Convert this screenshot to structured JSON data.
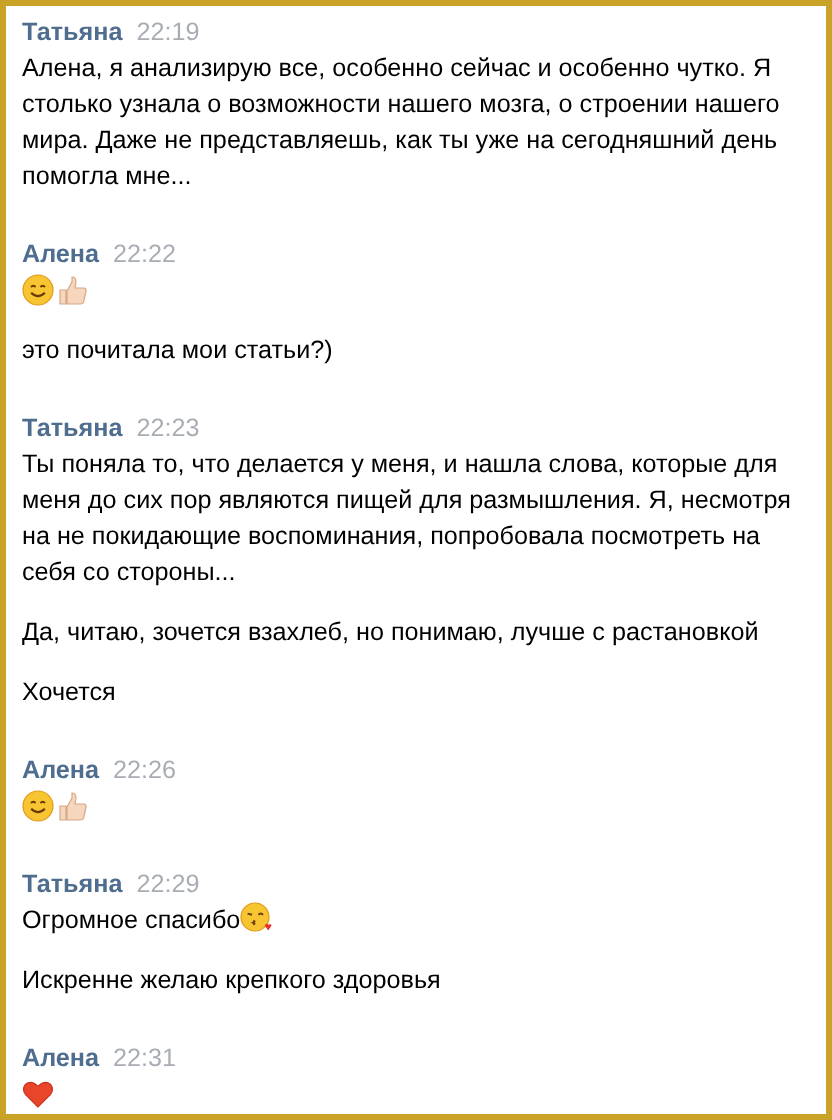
{
  "messages": [
    {
      "author": "Татьяна",
      "time": "22:19",
      "items": [
        {
          "kind": "text",
          "text": "Алена, я анализирую все, особенно сейчас и особенно чутко. Я столько узнала о возможности нашего мозга, о строении нашего мира. Даже не представляешь, как ты уже на сегодняшний день помогла мне..."
        }
      ]
    },
    {
      "author": "Алена",
      "time": "22:22",
      "items": [
        {
          "kind": "emoji",
          "icons": [
            {
              "kind": "smile"
            },
            {
              "kind": "thumb"
            }
          ]
        },
        {
          "kind": "text",
          "text": "это почитала мои статьи?)"
        }
      ]
    },
    {
      "author": "Татьяна",
      "time": "22:23",
      "items": [
        {
          "kind": "text",
          "text": "Ты поняла то, что делается у меня, и нашла слова, которые для меня до сих пор являются пищей для размышления. Я, несмотря на не покидающие воспоминания, попробовала посмотреть на себя со стороны..."
        },
        {
          "kind": "text",
          "text": "Да, читаю, зочется взахлеб, но понимаю, лучше с растановкой"
        },
        {
          "kind": "text",
          "text": "Хочется"
        }
      ]
    },
    {
      "author": "Алена",
      "time": "22:26",
      "items": [
        {
          "kind": "emoji",
          "icons": [
            {
              "kind": "smile"
            },
            {
              "kind": "thumb"
            }
          ]
        }
      ]
    },
    {
      "author": "Татьяна",
      "time": "22:29",
      "items": [
        {
          "kind": "text",
          "text": "Огромное спасибо",
          "icons": [
            {
              "kind": "kiss"
            }
          ]
        },
        {
          "kind": "text",
          "text": "Искренне желаю крепкого здоровья"
        }
      ]
    },
    {
      "author": "Алена",
      "time": "22:31",
      "items": [
        {
          "kind": "emoji",
          "icons": [
            {
              "kind": "heart"
            }
          ]
        }
      ]
    }
  ]
}
